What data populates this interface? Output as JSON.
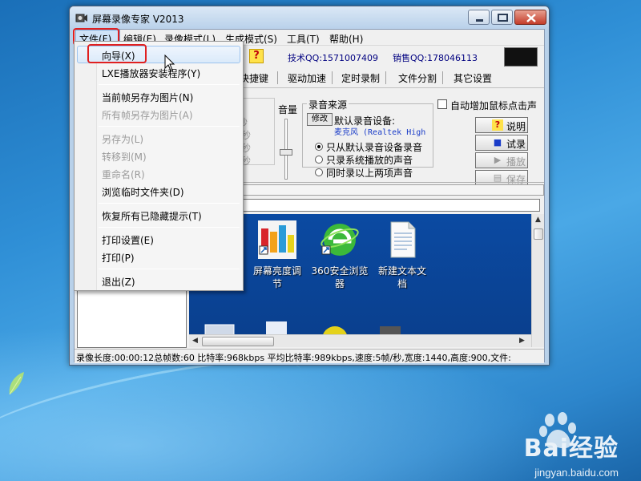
{
  "window": {
    "title": "屏幕录像专家 V2013"
  },
  "menubar": {
    "items": [
      "文件(F)",
      "编辑(E)",
      "录像模式(L)",
      "生成模式(S)",
      "工具(T)",
      "帮助(H)"
    ]
  },
  "toolbar": {
    "tech_qq": "技术QQ:1571007409",
    "sales_qq": "销售QQ:178046113",
    "help_mark": "?"
  },
  "tabs": [
    "快捷键",
    "驱动加速",
    "定时录制",
    "文件分割",
    "其它设置"
  ],
  "settings": {
    "fps_partial": [
      "秒",
      "/秒",
      "/秒",
      "/秒"
    ],
    "volume_label": "音量",
    "source_group_title": "录音来源",
    "device_button": "修改",
    "device_label": "默认录音设备:",
    "device_value": "麦克风 (Realtek High",
    "radio_options": [
      "只从默认录音设备录音",
      "只录系统播放的声音",
      "同时录以上两项声音"
    ],
    "radio_selected": 0,
    "checkbox_label": "自动增加鼠标点击声",
    "buttons": [
      {
        "label": "说明",
        "icon": "?",
        "enabled": true
      },
      {
        "label": "试录",
        "icon": "■",
        "enabled": true
      },
      {
        "label": "播放",
        "icon": "▶",
        "enabled": false
      },
      {
        "label": "保存",
        "icon": "▤",
        "enabled": false
      }
    ]
  },
  "preview": {
    "icons": [
      {
        "label_line1": "屏幕亮度调",
        "label_line2": "节"
      },
      {
        "label_line1": "360安全浏览",
        "label_line2": "器"
      },
      {
        "label_line1": "新建文本文",
        "label_line2": "档"
      }
    ]
  },
  "statusbar": {
    "text": "录像长度:00:00:12总帧数:60 比特率:968kbps 平均比特率:989kbps,速度:5帧/秒,宽度:1440,高度:900,文件:"
  },
  "file_menu": {
    "items": [
      {
        "label": "向导(X)",
        "enabled": true
      },
      {
        "label": "LXE播放器安装程序(Y)",
        "enabled": true
      },
      {
        "label": "当前帧另存为图片(N)",
        "enabled": true
      },
      {
        "label": "所有帧另存为图片(A)",
        "enabled": false
      },
      {
        "label": "另存为(L)",
        "enabled": false
      },
      {
        "label": "转移到(M)",
        "enabled": false
      },
      {
        "label": "重命名(R)",
        "enabled": false
      },
      {
        "label": "浏览临时文件夹(D)",
        "enabled": true
      },
      {
        "label": "恢复所有已隐藏提示(T)",
        "enabled": true
      },
      {
        "label": "打印设置(E)",
        "enabled": true
      },
      {
        "label": "打印(P)",
        "enabled": true
      },
      {
        "label": "退出(Z)",
        "enabled": true
      }
    ]
  },
  "watermark": {
    "brand": "Bai经验",
    "url": "jingyan.baidu.com"
  },
  "colors": {
    "highlight_red": "#e02020",
    "menu_hover": "#dbeafa",
    "qq_text": "#000080"
  }
}
